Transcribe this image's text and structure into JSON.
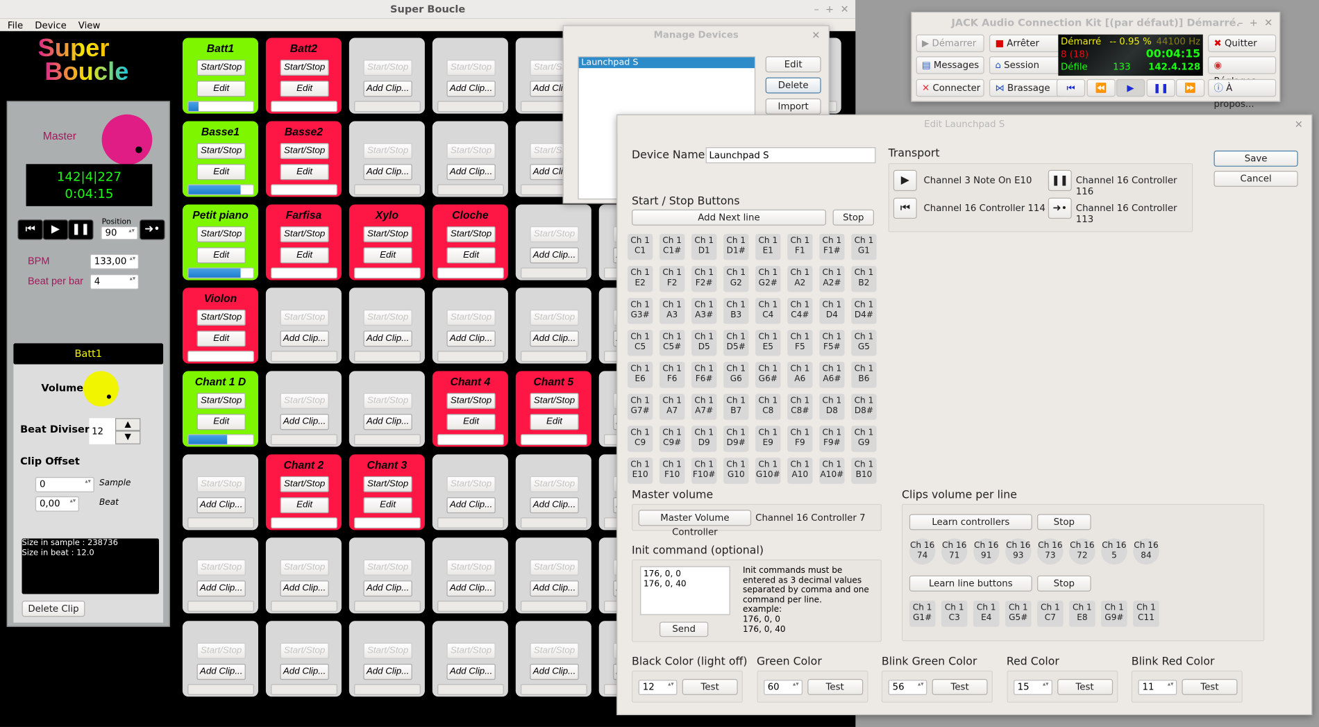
{
  "main": {
    "title": "Super Boucle",
    "menu": [
      "File",
      "Device",
      "View"
    ],
    "logo": "Super Boucle",
    "master_label": "Master",
    "master_color": "#e01d84",
    "bar_position": "142|4|227",
    "time": "0:04:15",
    "position_label": "Position",
    "position_value": "90",
    "bpm_label": "BPM",
    "bpm_value": "133,00",
    "bpb_label": "Beat per bar",
    "bpb_value": "4",
    "clip": {
      "name": "Batt1",
      "volume_label": "Volume",
      "volume_color": "#f2f500",
      "beat_diviser_label": "Beat Diviser",
      "beat_diviser_value": "12",
      "clip_offset_label": "Clip Offset",
      "sample_value": "0",
      "sample_label": "Sample",
      "beat_value": "0,00",
      "beat_label": "Beat",
      "info": [
        "Size in sample : 238736",
        "Size in beat : 12.0"
      ],
      "delete_label": "Delete Clip"
    }
  },
  "grid": {
    "start_stop": "Start/Stop",
    "edit": "Edit",
    "add_clip": "Add Clip...",
    "green": "#7ef600",
    "red": "#fe1744",
    "rows": [
      [
        {
          "name": "Batt1",
          "state": "green",
          "progress": 0.15
        },
        {
          "name": "Batt2",
          "state": "red",
          "progress": 0
        },
        null,
        null,
        null,
        null,
        null,
        null
      ],
      [
        {
          "name": "Basse1",
          "state": "green",
          "progress": 0.8
        },
        {
          "name": "Basse2",
          "state": "red",
          "progress": 0
        },
        null,
        null,
        null,
        null,
        null,
        null
      ],
      [
        {
          "name": "Petit piano",
          "state": "green",
          "progress": 0.8
        },
        {
          "name": "Farfisa",
          "state": "red",
          "progress": 0
        },
        {
          "name": "Xylo",
          "state": "red",
          "progress": 0
        },
        {
          "name": "Cloche",
          "state": "red",
          "progress": 0
        },
        null,
        null,
        null,
        null
      ],
      [
        {
          "name": "Violon",
          "state": "red",
          "progress": 0
        },
        null,
        null,
        null,
        null,
        null,
        null,
        null
      ],
      [
        {
          "name": "Chant 1 D",
          "state": "green",
          "progress": 0.6
        },
        null,
        null,
        {
          "name": "Chant 4",
          "state": "red",
          "progress": 0
        },
        {
          "name": "Chant 5",
          "state": "red",
          "progress": 0
        },
        null,
        null,
        null
      ],
      [
        null,
        {
          "name": "Chant 2",
          "state": "red",
          "progress": 0
        },
        {
          "name": "Chant 3",
          "state": "red",
          "progress": 0
        },
        null,
        null,
        null,
        null,
        null
      ],
      [
        null,
        null,
        null,
        null,
        null,
        null,
        null,
        null
      ],
      [
        null,
        null,
        null,
        null,
        null,
        null,
        null,
        null
      ]
    ]
  },
  "manage": {
    "title": "Manage Devices",
    "devices": [
      "Launchpad S"
    ],
    "edit": "Edit",
    "delete": "Delete",
    "import": "Import"
  },
  "jack": {
    "title": "JACK Audio Connection Kit [(par défaut)] Démarré.",
    "start": "Démarrer",
    "stop": "Arrêter",
    "quit": "Quitter",
    "messages": "Messages",
    "session": "Session",
    "settings": "Réglages...",
    "connect": "Connecter",
    "patchbay": "Brassage",
    "about": "À propos...",
    "status": "Démarré",
    "dsp": "-- 0.95 %",
    "rate": "44100 Hz",
    "xruns": "8 (18)",
    "time": "00:04:15",
    "transport": "Défile",
    "bpm": "133",
    "bbt": "142.4.128"
  },
  "edit": {
    "title": "Edit Launchpad S",
    "device_name_label": "Device Name",
    "device_name": "Launchpad S",
    "save": "Save",
    "cancel": "Cancel",
    "transport_label": "Transport",
    "transport": {
      "play": "Channel 3 Note On E10",
      "pause": "Channel 16 Controller 116",
      "rewind": "Channel 16 Controller 114",
      "goto": "Channel 16 Controller 113"
    },
    "start_stop_label": "Start / Stop Buttons",
    "add_next_line": "Add Next line",
    "stop": "Stop",
    "start_stop_buttons": [
      [
        "C1",
        "C1#",
        "D1",
        "D1#",
        "E1",
        "F1",
        "F1#",
        "G1"
      ],
      [
        "E2",
        "F2",
        "F2#",
        "G2",
        "G2#",
        "A2",
        "A2#",
        "B2"
      ],
      [
        "G3#",
        "A3",
        "A3#",
        "B3",
        "C4",
        "C4#",
        "D4",
        "D4#"
      ],
      [
        "C5",
        "C5#",
        "D5",
        "D5#",
        "E5",
        "F5",
        "F5#",
        "G5"
      ],
      [
        "E6",
        "F6",
        "F6#",
        "G6",
        "G6#",
        "A6",
        "A6#",
        "B6"
      ],
      [
        "G7#",
        "A7",
        "A7#",
        "B7",
        "C8",
        "C8#",
        "D8",
        "D8#"
      ],
      [
        "C9",
        "C9#",
        "D9",
        "D9#",
        "E9",
        "F9",
        "F9#",
        "G9"
      ],
      [
        "E10",
        "F10",
        "F10#",
        "G10",
        "G10#",
        "A10",
        "A10#",
        "B10"
      ]
    ],
    "channel_prefix": "Ch 1",
    "master_volume_label": "Master volume",
    "master_volume_button": "Master Volume Controller",
    "master_volume_value": "Channel 16 Controller 7",
    "init_label": "Init command (optional)",
    "init_text": "176, 0, 0\n176, 0, 40",
    "init_help": "Init commands must be\nentered as 3 decimal values\nseparated by comma and one\ncommand per line.\nexample:\n176, 0, 0\n176, 0, 40",
    "send": "Send",
    "clips_volume_label": "Clips volume per line",
    "learn_controllers": "Learn controllers",
    "learn_line_buttons": "Learn line buttons",
    "controllers": [
      "Ch 16\n74",
      "Ch 16\n71",
      "Ch 16\n91",
      "Ch 16\n93",
      "Ch 16\n73",
      "Ch 16\n72",
      "Ch 16\n5",
      "Ch 16\n84"
    ],
    "line_buttons": [
      "Ch 1\nG1#",
      "Ch 1\nC3",
      "Ch 1\nE4",
      "Ch 1\nG5#",
      "Ch 1\nC7",
      "Ch 1\nE8",
      "Ch 1\nG9#",
      "Ch 1\nC11"
    ],
    "test": "Test",
    "colors": [
      {
        "label": "Black Color (light off)",
        "value": "12"
      },
      {
        "label": "Green Color",
        "value": "60"
      },
      {
        "label": "Blink Green Color",
        "value": "56"
      },
      {
        "label": "Red Color",
        "value": "15"
      },
      {
        "label": "Blink Red Color",
        "value": "11"
      }
    ]
  }
}
